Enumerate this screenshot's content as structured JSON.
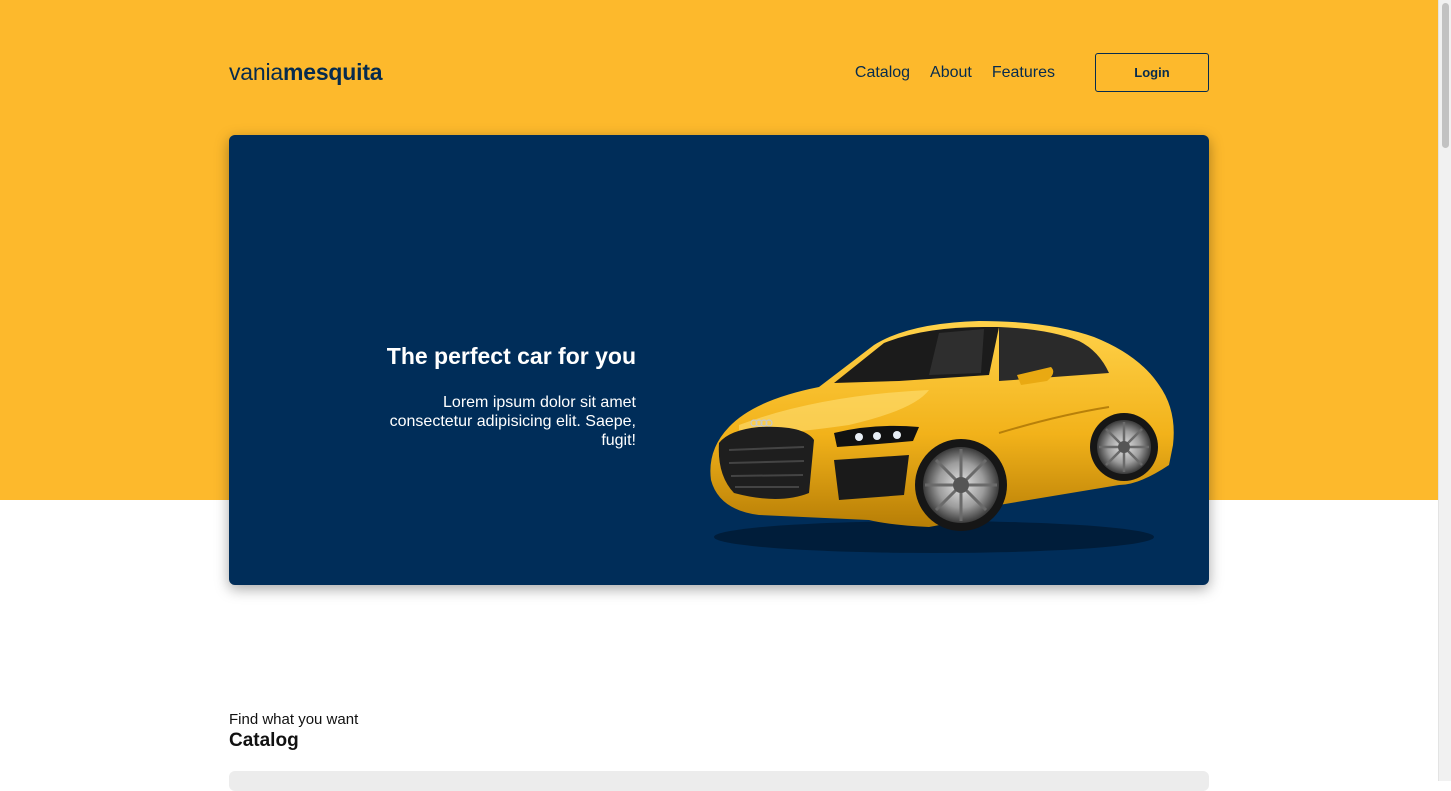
{
  "brand": {
    "logo_light": "vania",
    "logo_bold": "mesquita"
  },
  "nav": {
    "items": [
      {
        "label": "Catalog"
      },
      {
        "label": "About"
      },
      {
        "label": "Features"
      }
    ],
    "login_label": "Login"
  },
  "hero": {
    "title": "The perfect car for you",
    "body": "Lorem ipsum dolor sit amet consectetur adipisicing elit. Saepe, fugit!"
  },
  "catalog_section": {
    "subtitle": "Find what you want",
    "title": "Catalog"
  },
  "colors": {
    "accent_yellow": "#FDB92C",
    "navy": "#002D59",
    "brand_text": "#062B4E"
  }
}
